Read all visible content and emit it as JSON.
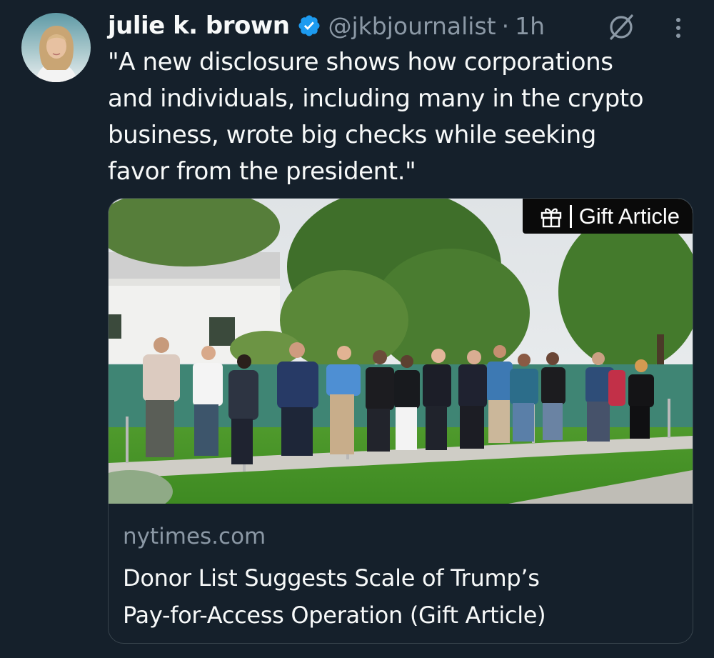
{
  "author": {
    "display_name": "julie k. brown",
    "handle": "@jkbjournalist",
    "separator": "·",
    "time": "1h",
    "verified": true,
    "avatar_icon": "user-avatar-photo"
  },
  "tweet": {
    "text": "\"A new disclosure shows how corporations\nand individuals, including many in the crypto\nbusiness, wrote big checks while seeking\nfavor from the president.\""
  },
  "header_icons": {
    "grok": "grok-slash-circle-icon",
    "more": "more-vertical-dots-icon"
  },
  "card": {
    "badge_label": "Gift Article",
    "badge_icon": "gift-icon",
    "domain": "nytimes.com",
    "title": "Donor List Suggests Scale of Trump’s\nPay-for-Access Operation (Gift Article)"
  },
  "colors": {
    "background": "#15202b",
    "text_primary": "#f7f9f9",
    "text_secondary": "#8b98a5",
    "verified_blue": "#1d9bf0",
    "card_border": "#38444d"
  }
}
